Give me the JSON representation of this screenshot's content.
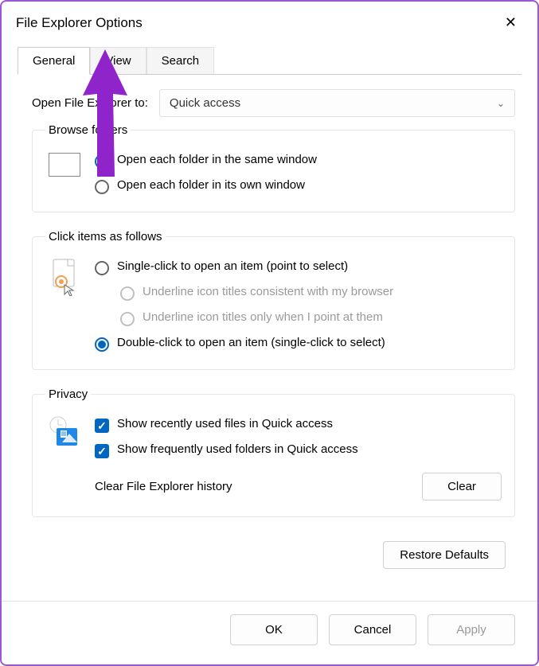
{
  "window": {
    "title": "File Explorer Options"
  },
  "tabs": {
    "general": "General",
    "view": "View",
    "search": "Search"
  },
  "open_to": {
    "label": "Open File Explorer to:",
    "selected": "Quick access"
  },
  "browse_folders": {
    "legend": "Browse folders",
    "same_window": "Open each folder in the same window",
    "own_window": "Open each folder in its own window"
  },
  "click_items": {
    "legend": "Click items as follows",
    "single_click": "Single-click to open an item (point to select)",
    "underline_browser": "Underline icon titles consistent with my browser",
    "underline_point": "Underline icon titles only when I point at them",
    "double_click": "Double-click to open an item (single-click to select)"
  },
  "privacy": {
    "legend": "Privacy",
    "recent_files": "Show recently used files in Quick access",
    "frequent_folders": "Show frequently used folders in Quick access",
    "clear_label": "Clear File Explorer history",
    "clear_button": "Clear"
  },
  "buttons": {
    "restore": "Restore Defaults",
    "ok": "OK",
    "cancel": "Cancel",
    "apply": "Apply"
  }
}
